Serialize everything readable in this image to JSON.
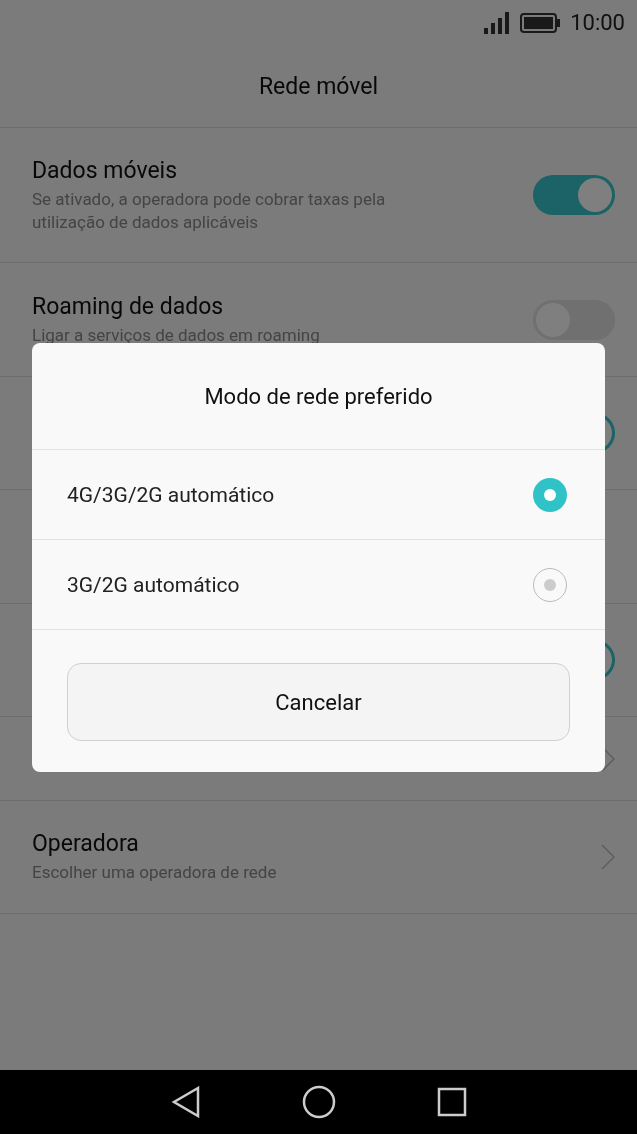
{
  "status_bar": {
    "time": "10:00"
  },
  "header": {
    "title": "Rede móvel"
  },
  "settings": [
    {
      "kind": "toggle",
      "title": "Dados móveis",
      "subtitle": "Se ativado, a operadora pode cobrar taxas pela utilização de dados aplicáveis",
      "on": true
    },
    {
      "kind": "toggle",
      "title": "Roaming de dados",
      "subtitle": "Ligar a serviços de dados em roaming",
      "on": false
    },
    {
      "kind": "toggle",
      "on": true
    },
    {
      "kind": "blank"
    },
    {
      "kind": "toggle",
      "on": true
    },
    {
      "kind": "link"
    },
    {
      "kind": "link",
      "title": "Operadora",
      "subtitle": "Escolher uma operadora de rede"
    }
  ],
  "dialog": {
    "title": "Modo de rede preferido",
    "options": [
      {
        "label": "4G/3G/2G automático",
        "selected": true
      },
      {
        "label": "3G/2G automático",
        "selected": false
      }
    ],
    "cancel": "Cancelar"
  }
}
